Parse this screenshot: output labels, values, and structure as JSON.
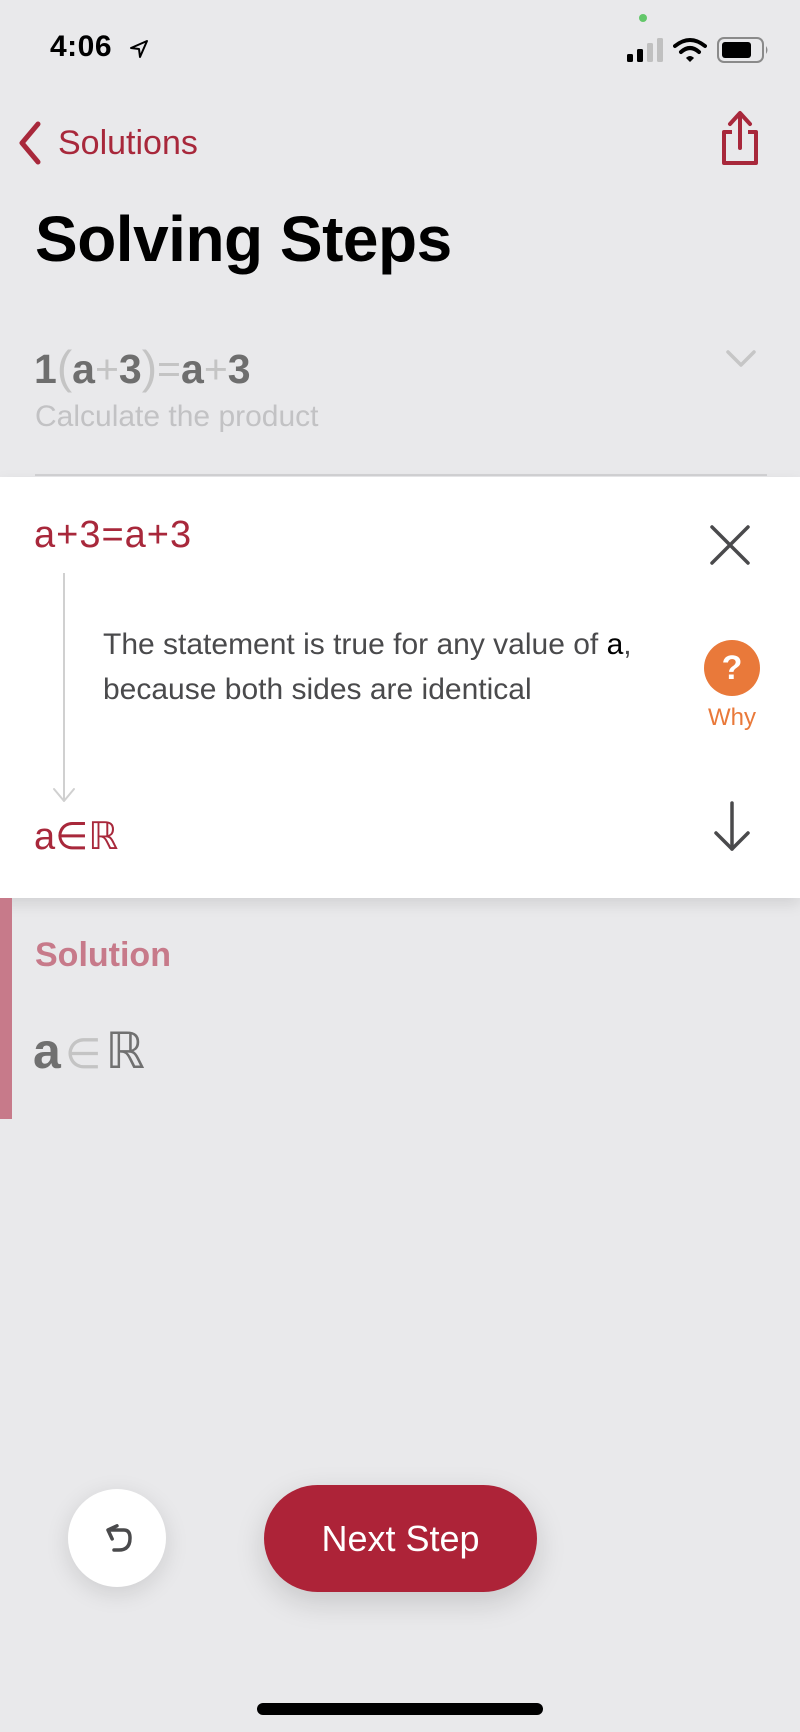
{
  "status_bar": {
    "time": "4:06",
    "icons": [
      "location-arrow-icon",
      "signal-icon",
      "wifi-icon",
      "battery-icon"
    ]
  },
  "nav": {
    "back_label": "Solutions",
    "title": "Solving Steps",
    "share_icon": "share-icon"
  },
  "previous_step": {
    "expression": {
      "coef": "1",
      "open_paren": "(",
      "a1": "a",
      "plus1": "+",
      "n1": "3",
      "close_paren": ")",
      "eq": "=",
      "a2": "a",
      "plus2": "+",
      "n2": "3"
    },
    "description": "Calculate the product"
  },
  "current_step": {
    "expression": "a+3=a+3",
    "explanation_pre": "The statement is true for any value of ",
    "explanation_var": "a",
    "explanation_post": ", because both sides are identical",
    "why_icon": "?",
    "why_label": "Why",
    "result": {
      "var": "a",
      "op": "∈",
      "set": "ℝ"
    }
  },
  "solution": {
    "label": "Solution",
    "var": "a",
    "op": "∈",
    "set": "ℝ"
  },
  "actions": {
    "next_label": "Next Step"
  },
  "colors": {
    "accent": "#a8283b",
    "button": "#ad2338",
    "why": "#e9793a",
    "solution": "#c77a8a",
    "background": "#e9e9eb"
  }
}
